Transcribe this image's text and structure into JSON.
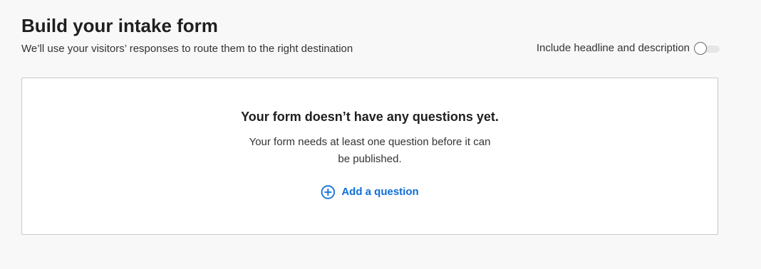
{
  "header": {
    "title": "Build your intake form",
    "subtitle": "We’ll use your visitors’ responses to route them to the right destination"
  },
  "toggle": {
    "label": "Include headline and description",
    "state": "off"
  },
  "empty_state": {
    "title": "Your form doesn’t have any questions yet.",
    "description": "Your form needs at least one question before it can be published.",
    "action_label": "Add a question",
    "action_icon": "plus-circle-icon"
  },
  "colors": {
    "background": "#f8f8f8",
    "card": "#ffffff",
    "accent": "#0f6fd6",
    "text": "#1f1f1f"
  }
}
